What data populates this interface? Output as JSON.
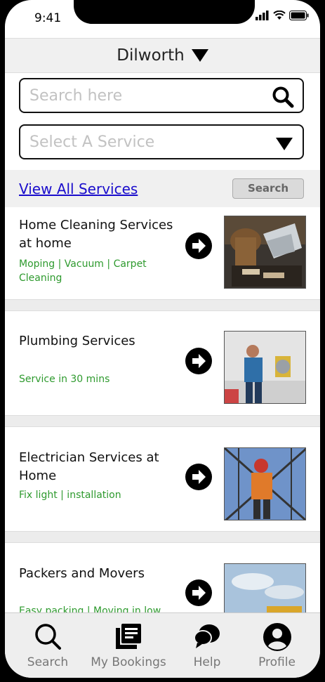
{
  "status": {
    "time": "9:41"
  },
  "location": {
    "name": "Dilworth"
  },
  "search": {
    "placeholder": "Search here"
  },
  "service_select": {
    "placeholder": "Select A Service"
  },
  "actions": {
    "view_all": "View All Services",
    "search_button": "Search"
  },
  "services": [
    {
      "title": "Home Cleaning Services at home",
      "subtitle": "Moping | Vacuum | Carpet Cleaning"
    },
    {
      "title": "Plumbing Services",
      "subtitle": "Service in 30 mins"
    },
    {
      "title": "Electrician Services at Home",
      "subtitle": "Fix light | installation"
    },
    {
      "title": "Packers and Movers",
      "subtitle": "Easy packing | Moving in low"
    }
  ],
  "tabs": [
    {
      "label": "Search",
      "icon": "search-icon"
    },
    {
      "label": "My Bookings",
      "icon": "bookings-icon"
    },
    {
      "label": "Help",
      "icon": "chat-icon"
    },
    {
      "label": "Profile",
      "icon": "profile-icon"
    }
  ],
  "colors": {
    "link": "#1a0dcc",
    "subtitle_green": "#2e9a2e",
    "bar_bg": "#f0f0f0"
  }
}
